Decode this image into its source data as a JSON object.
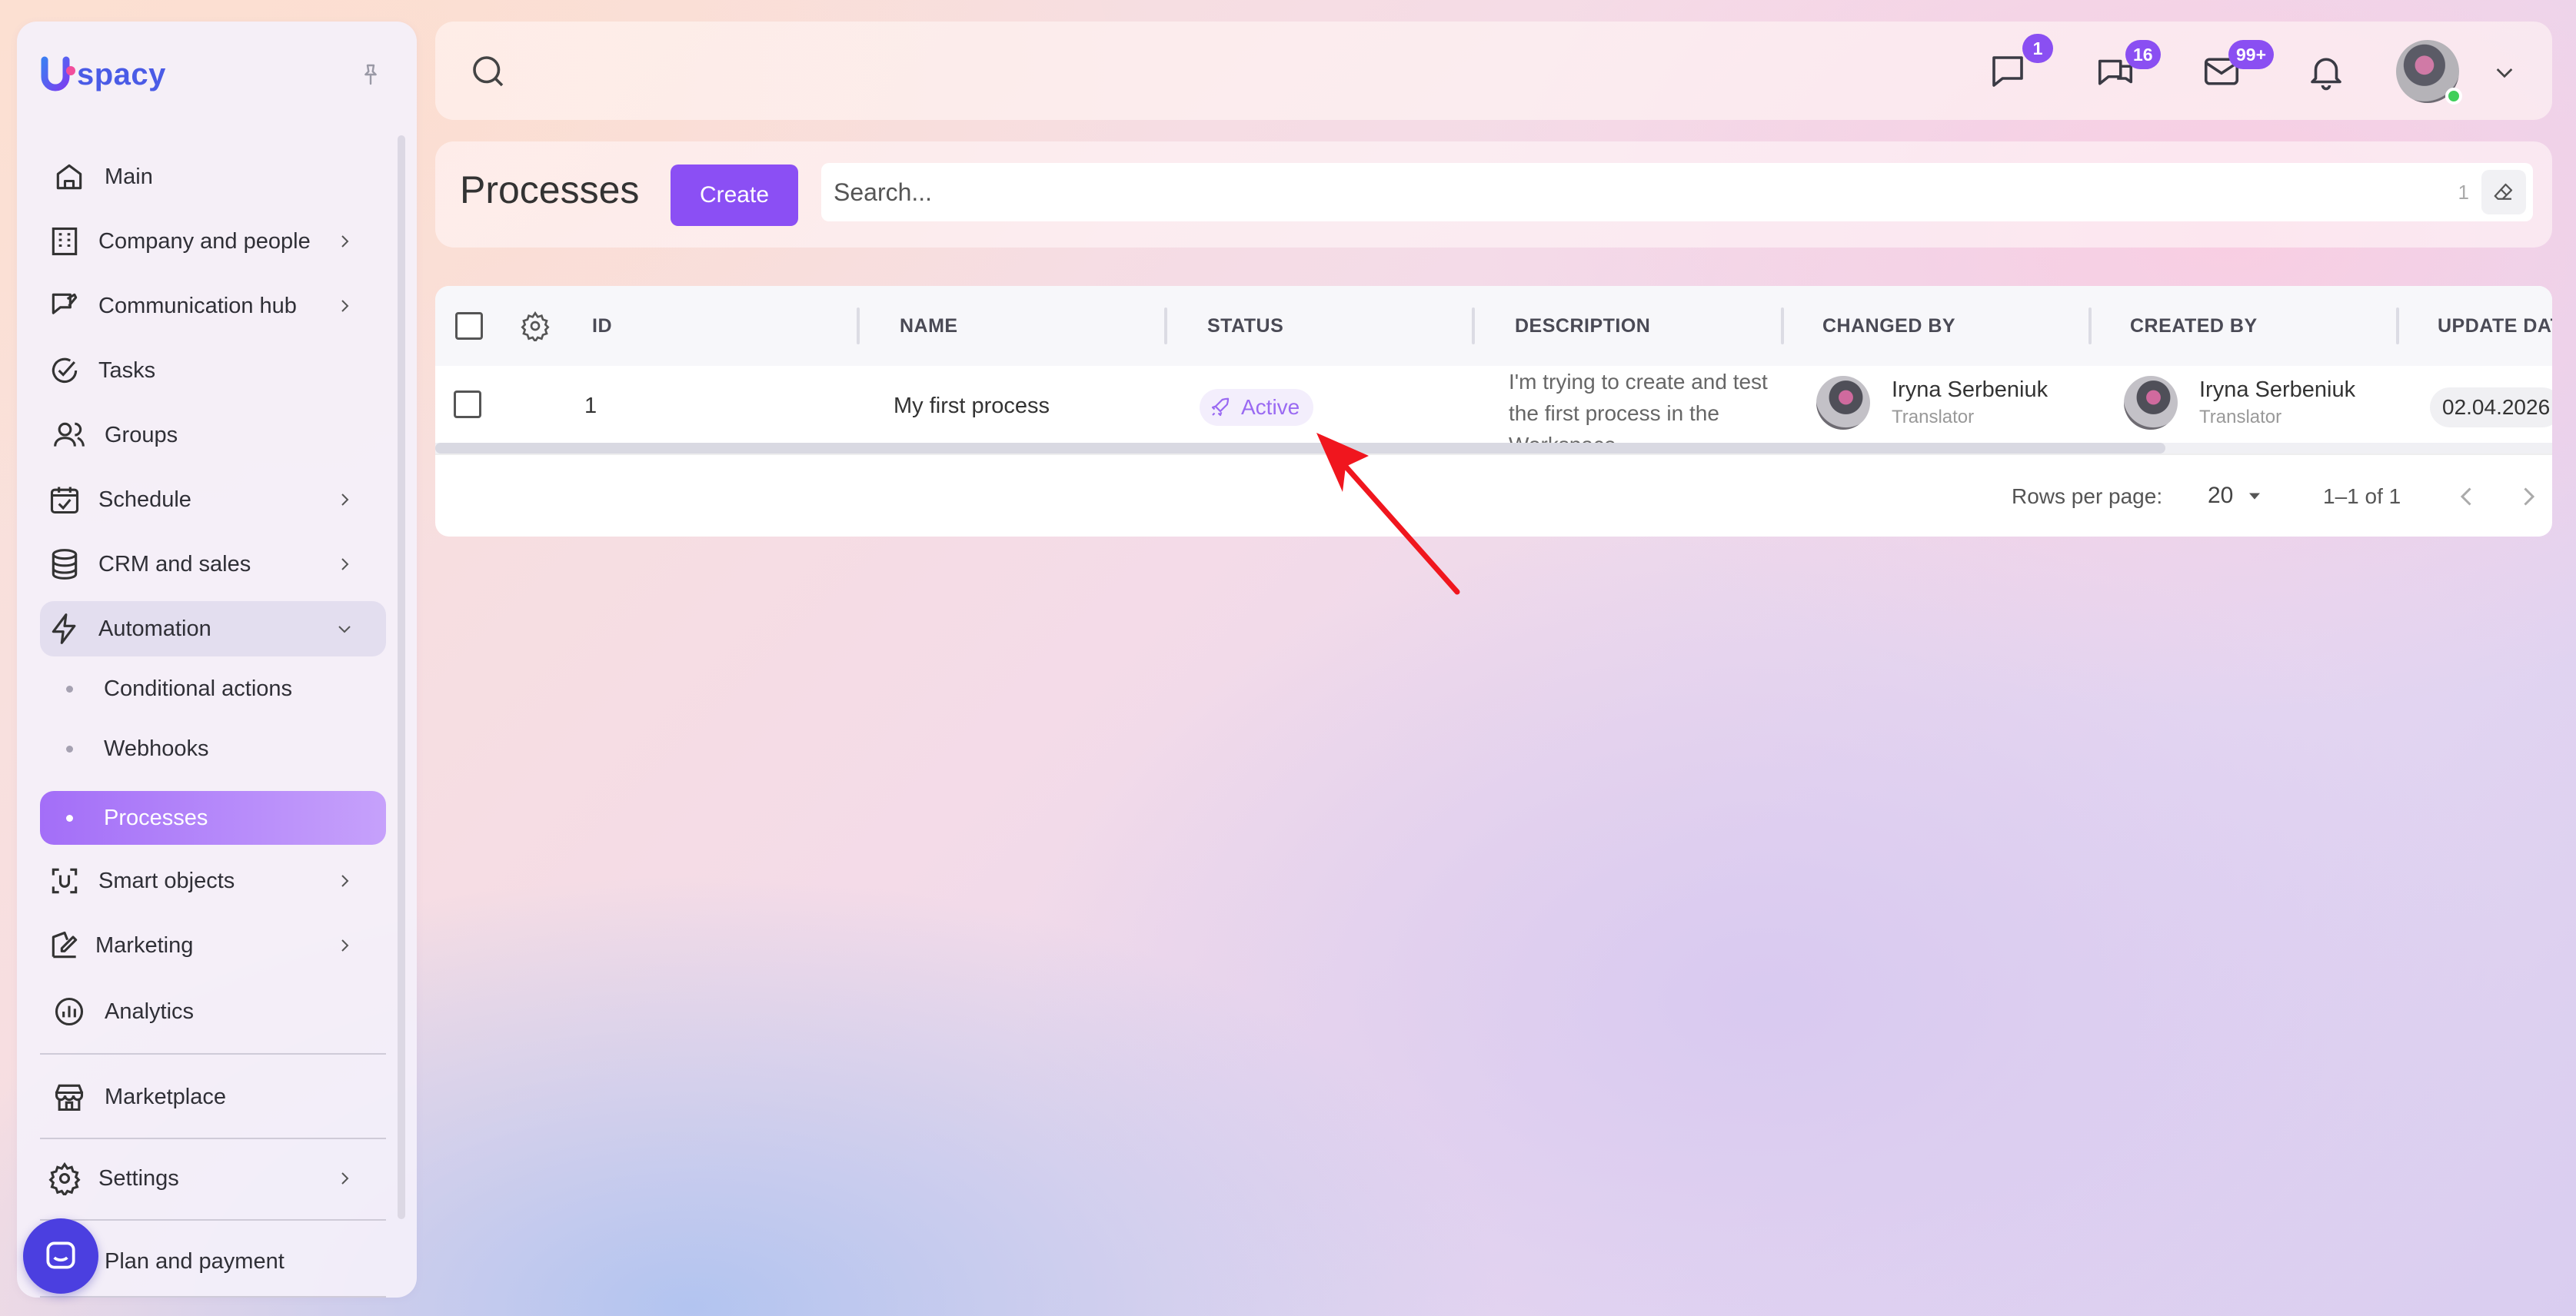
{
  "app": {
    "logo_text": "spacy",
    "brand_color": "#4a5be6",
    "accent_color": "#8b4ff4"
  },
  "sidebar": {
    "items": [
      {
        "id": "main",
        "label": "Main",
        "icon": "home-icon"
      },
      {
        "id": "company",
        "label": "Company and people",
        "icon": "building-icon",
        "has_children": true
      },
      {
        "id": "communication",
        "label": "Communication hub",
        "icon": "communication-icon",
        "has_children": true
      },
      {
        "id": "tasks",
        "label": "Tasks",
        "icon": "check-circle-icon"
      },
      {
        "id": "groups",
        "label": "Groups",
        "icon": "users-icon"
      },
      {
        "id": "schedule",
        "label": "Schedule",
        "icon": "calendar-icon",
        "has_children": true
      },
      {
        "id": "crm",
        "label": "CRM and sales",
        "icon": "database-icon",
        "has_children": true
      },
      {
        "id": "automation",
        "label": "Automation",
        "icon": "lightning-icon",
        "expanded": true
      }
    ],
    "automation_children": [
      {
        "label": "Conditional actions"
      },
      {
        "label": "Webhooks"
      },
      {
        "label": "Processes",
        "active": true
      }
    ],
    "items_after": [
      {
        "id": "smart",
        "label": "Smart objects",
        "icon": "scan-icon",
        "has_children": true
      },
      {
        "id": "marketing",
        "label": "Marketing",
        "icon": "marketing-icon",
        "has_children": true
      },
      {
        "id": "analytics",
        "label": "Analytics",
        "icon": "analytics-icon"
      }
    ],
    "marketplace": "Marketplace",
    "settings": "Settings",
    "plan": "Plan and payment"
  },
  "topbar": {
    "messages_badge": "1",
    "chats_badge": "16",
    "mail_badge": "99+"
  },
  "header": {
    "title": "Processes",
    "create_label": "Create",
    "search_placeholder": "Search...",
    "search_count": "1"
  },
  "table": {
    "columns": [
      "ID",
      "NAME",
      "STATUS",
      "DESCRIPTION",
      "CHANGED BY",
      "CREATED BY",
      "UPDATE DAT"
    ],
    "rows": [
      {
        "id": "1",
        "name": "My first process",
        "status": "Active",
        "description": "I'm trying to create and test the first process in the Workspace",
        "changed_by": {
          "name": "Iryna Serbeniuk",
          "role": "Translator"
        },
        "created_by": {
          "name": "Iryna Serbeniuk",
          "role": "Translator"
        },
        "update_date": "02.04.2026"
      }
    ],
    "footer": {
      "rows_per_page_label": "Rows per page:",
      "rows_per_page_value": "20",
      "range": "1–1 of 1"
    }
  }
}
